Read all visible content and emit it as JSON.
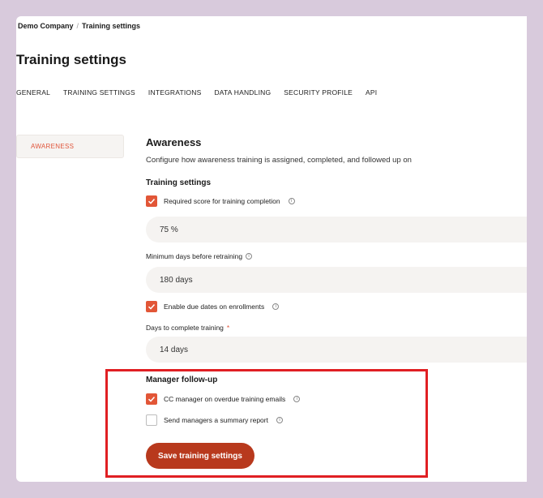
{
  "breadcrumb": {
    "company": "Demo Company",
    "separator": "/",
    "current": "Training settings"
  },
  "page_title": "Training settings",
  "tabs": [
    {
      "label": "GENERAL"
    },
    {
      "label": "TRAINING SETTINGS"
    },
    {
      "label": "INTEGRATIONS"
    },
    {
      "label": "DATA HANDLING"
    },
    {
      "label": "SECURITY PROFILE"
    },
    {
      "label": "API"
    }
  ],
  "sidebar": {
    "items": [
      {
        "label": "AWARENESS"
      }
    ]
  },
  "section": {
    "title": "Awareness",
    "description": "Configure how awareness training is assigned, completed, and followed up on",
    "training_settings_title": "Training settings",
    "required_score": {
      "label": "Required score for training completion",
      "checked": true,
      "value": "75 %"
    },
    "min_days": {
      "label": "Minimum days before retraining",
      "value": "180 days"
    },
    "due_dates": {
      "label": "Enable due dates on enrollments",
      "checked": true
    },
    "days_to_complete": {
      "label": "Days to complete training",
      "required_mark": "*",
      "value": "14 days"
    },
    "manager_followup_title": "Manager follow-up",
    "cc_manager": {
      "label": "CC manager on overdue training emails",
      "checked": true
    },
    "summary_report": {
      "label": "Send managers a summary report",
      "checked": false
    }
  },
  "save_label": "Save training settings",
  "colors": {
    "accent": "#e25637",
    "button": "#b8391d",
    "highlight": "#e01f23",
    "frame": "#d8cadc"
  }
}
